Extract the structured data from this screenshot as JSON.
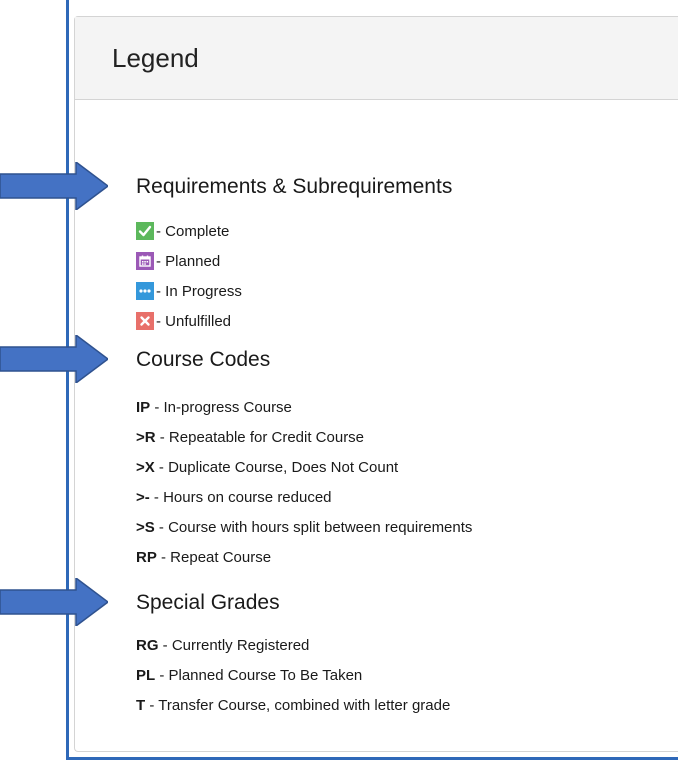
{
  "legend": {
    "title": "Legend"
  },
  "sections": {
    "requirements": {
      "title": "Requirements & Subrequirements",
      "items": [
        {
          "icon": "check-icon",
          "color": "#5cb85c",
          "label": "- Complete"
        },
        {
          "icon": "calendar-icon",
          "color": "#9b59b6",
          "label": "- Planned"
        },
        {
          "icon": "ellipsis-icon",
          "color": "#3498db",
          "label": "- In Progress"
        },
        {
          "icon": "x-icon",
          "color": "#e8706a",
          "label": "- Unfulfilled"
        }
      ]
    },
    "course_codes": {
      "title": "Course Codes",
      "items": [
        {
          "code": "IP",
          "desc": " - In-progress Course"
        },
        {
          "code": ">R",
          "desc": " - Repeatable for Credit Course"
        },
        {
          "code": ">X",
          "desc": " - Duplicate Course, Does Not Count"
        },
        {
          "code": ">-",
          "desc": " - Hours on course reduced"
        },
        {
          "code": ">S",
          "desc": " - Course with hours split between requirements"
        },
        {
          "code": "RP",
          "desc": " - Repeat Course"
        }
      ]
    },
    "special_grades": {
      "title": "Special Grades",
      "items": [
        {
          "code": "RG",
          "desc": " - Currently Registered"
        },
        {
          "code": "PL",
          "desc": " - Planned Course To Be Taken"
        },
        {
          "code": "T",
          "desc": " - Transfer Course, combined with letter grade"
        }
      ]
    }
  },
  "colors": {
    "arrow": "#4472c4",
    "arrow_border": "#2f528f",
    "frame": "#2e68b8"
  }
}
